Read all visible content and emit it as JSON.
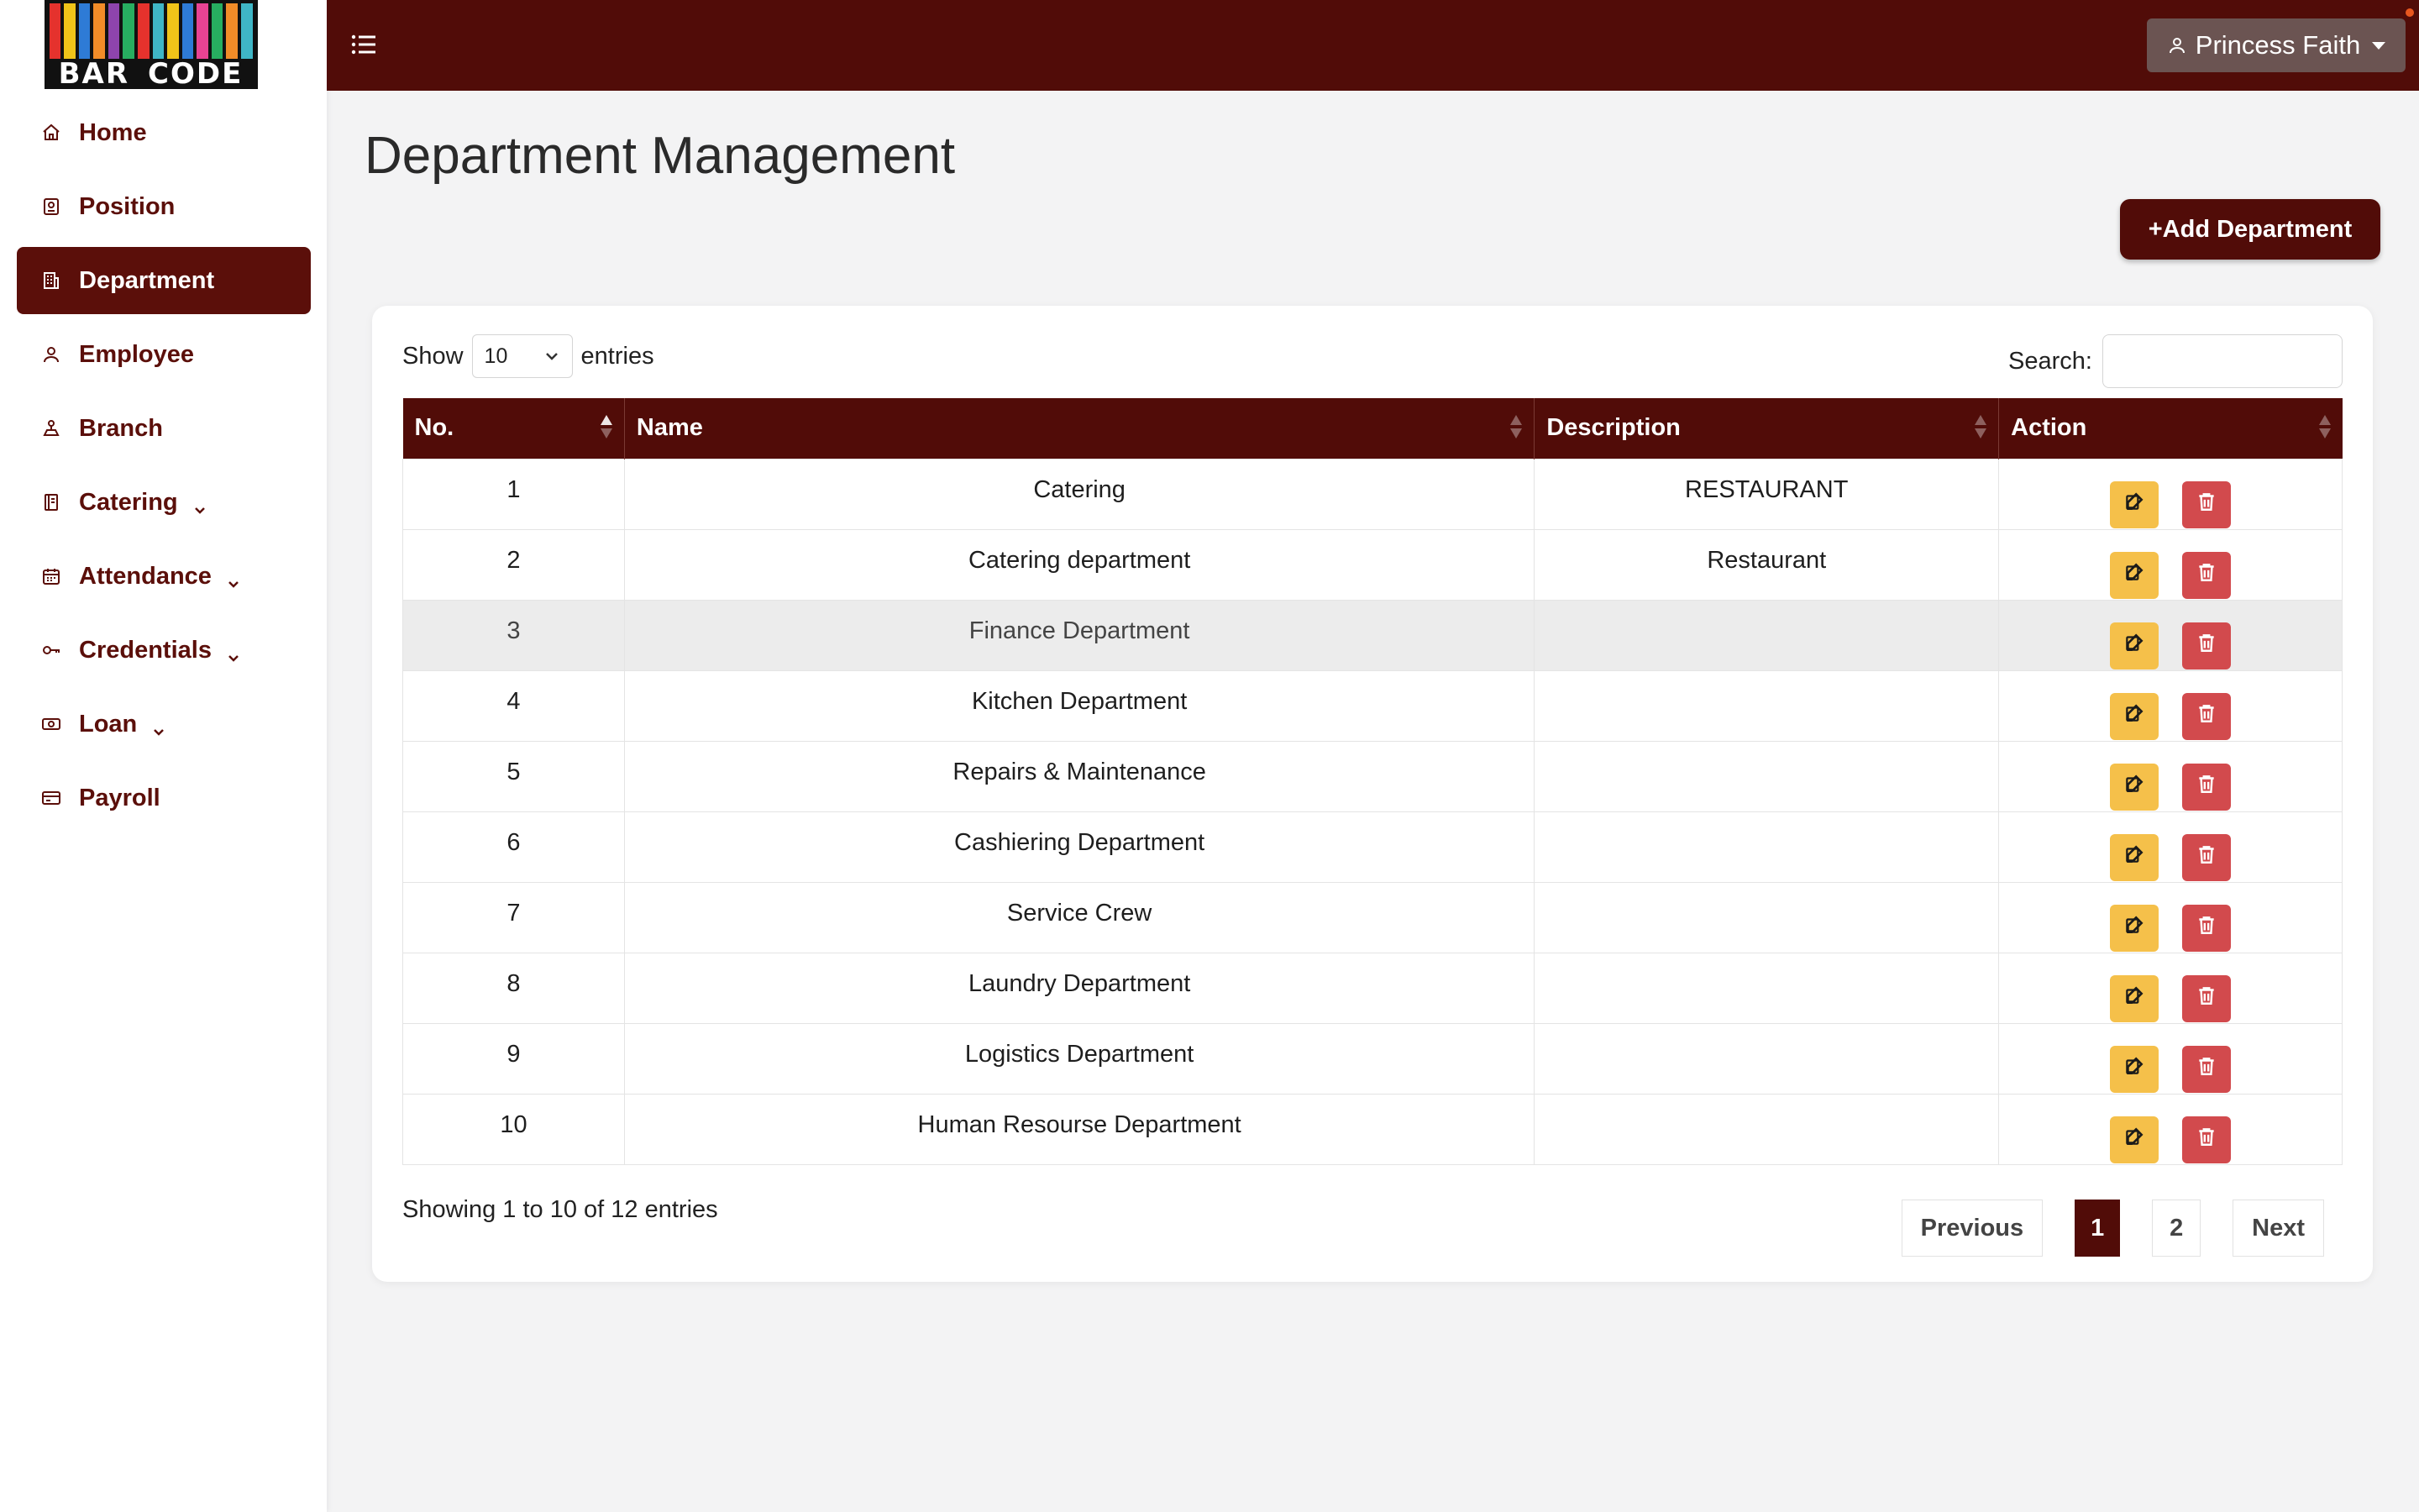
{
  "logo": {
    "left_word": "BAR",
    "right_word": "CODE"
  },
  "topbar": {
    "user_name": "Princess Faith"
  },
  "sidebar": {
    "items": [
      {
        "label": "Home",
        "icon": "home-icon",
        "active": false,
        "has_submenu": false
      },
      {
        "label": "Position",
        "icon": "badge-icon",
        "active": false,
        "has_submenu": false
      },
      {
        "label": "Department",
        "icon": "building-icon",
        "active": true,
        "has_submenu": false
      },
      {
        "label": "Employee",
        "icon": "person-icon",
        "active": false,
        "has_submenu": false
      },
      {
        "label": "Branch",
        "icon": "branch-icon",
        "active": false,
        "has_submenu": false
      },
      {
        "label": "Catering",
        "icon": "menu-book-icon",
        "active": false,
        "has_submenu": true
      },
      {
        "label": "Attendance",
        "icon": "calendar-icon",
        "active": false,
        "has_submenu": true
      },
      {
        "label": "Credentials",
        "icon": "key-icon",
        "active": false,
        "has_submenu": true
      },
      {
        "label": "Loan",
        "icon": "cash-icon",
        "active": false,
        "has_submenu": true
      },
      {
        "label": "Payroll",
        "icon": "card-icon",
        "active": false,
        "has_submenu": false
      }
    ]
  },
  "main": {
    "title": "Department Management",
    "add_button": "+Add Department",
    "length": {
      "show": "Show",
      "value": "10",
      "entries": "entries"
    },
    "search": {
      "label": "Search:",
      "value": "",
      "placeholder": ""
    },
    "table": {
      "headers": [
        "No.",
        "Name",
        "Description",
        "Action"
      ],
      "rows": [
        {
          "no": "1",
          "name": "Catering",
          "description": "RESTAURANT"
        },
        {
          "no": "2",
          "name": "Catering department",
          "description": "Restaurant"
        },
        {
          "no": "3",
          "name": "Finance Department",
          "description": ""
        },
        {
          "no": "4",
          "name": "Kitchen Department",
          "description": ""
        },
        {
          "no": "5",
          "name": "Repairs & Maintenance",
          "description": ""
        },
        {
          "no": "6",
          "name": "Cashiering Department",
          "description": ""
        },
        {
          "no": "7",
          "name": "Service Crew",
          "description": ""
        },
        {
          "no": "8",
          "name": "Laundry Department",
          "description": ""
        },
        {
          "no": "9",
          "name": "Logistics Department",
          "description": ""
        },
        {
          "no": "10",
          "name": "Human Resourse Department",
          "description": ""
        }
      ]
    },
    "info": "Showing 1 to 10 of 12 entries",
    "pagination": {
      "previous": "Previous",
      "pages": [
        "1",
        "2"
      ],
      "current": "1",
      "next": "Next"
    }
  },
  "colors": {
    "brand": "#510c08",
    "edit": "#f5c04a",
    "delete": "#d24a4d"
  }
}
